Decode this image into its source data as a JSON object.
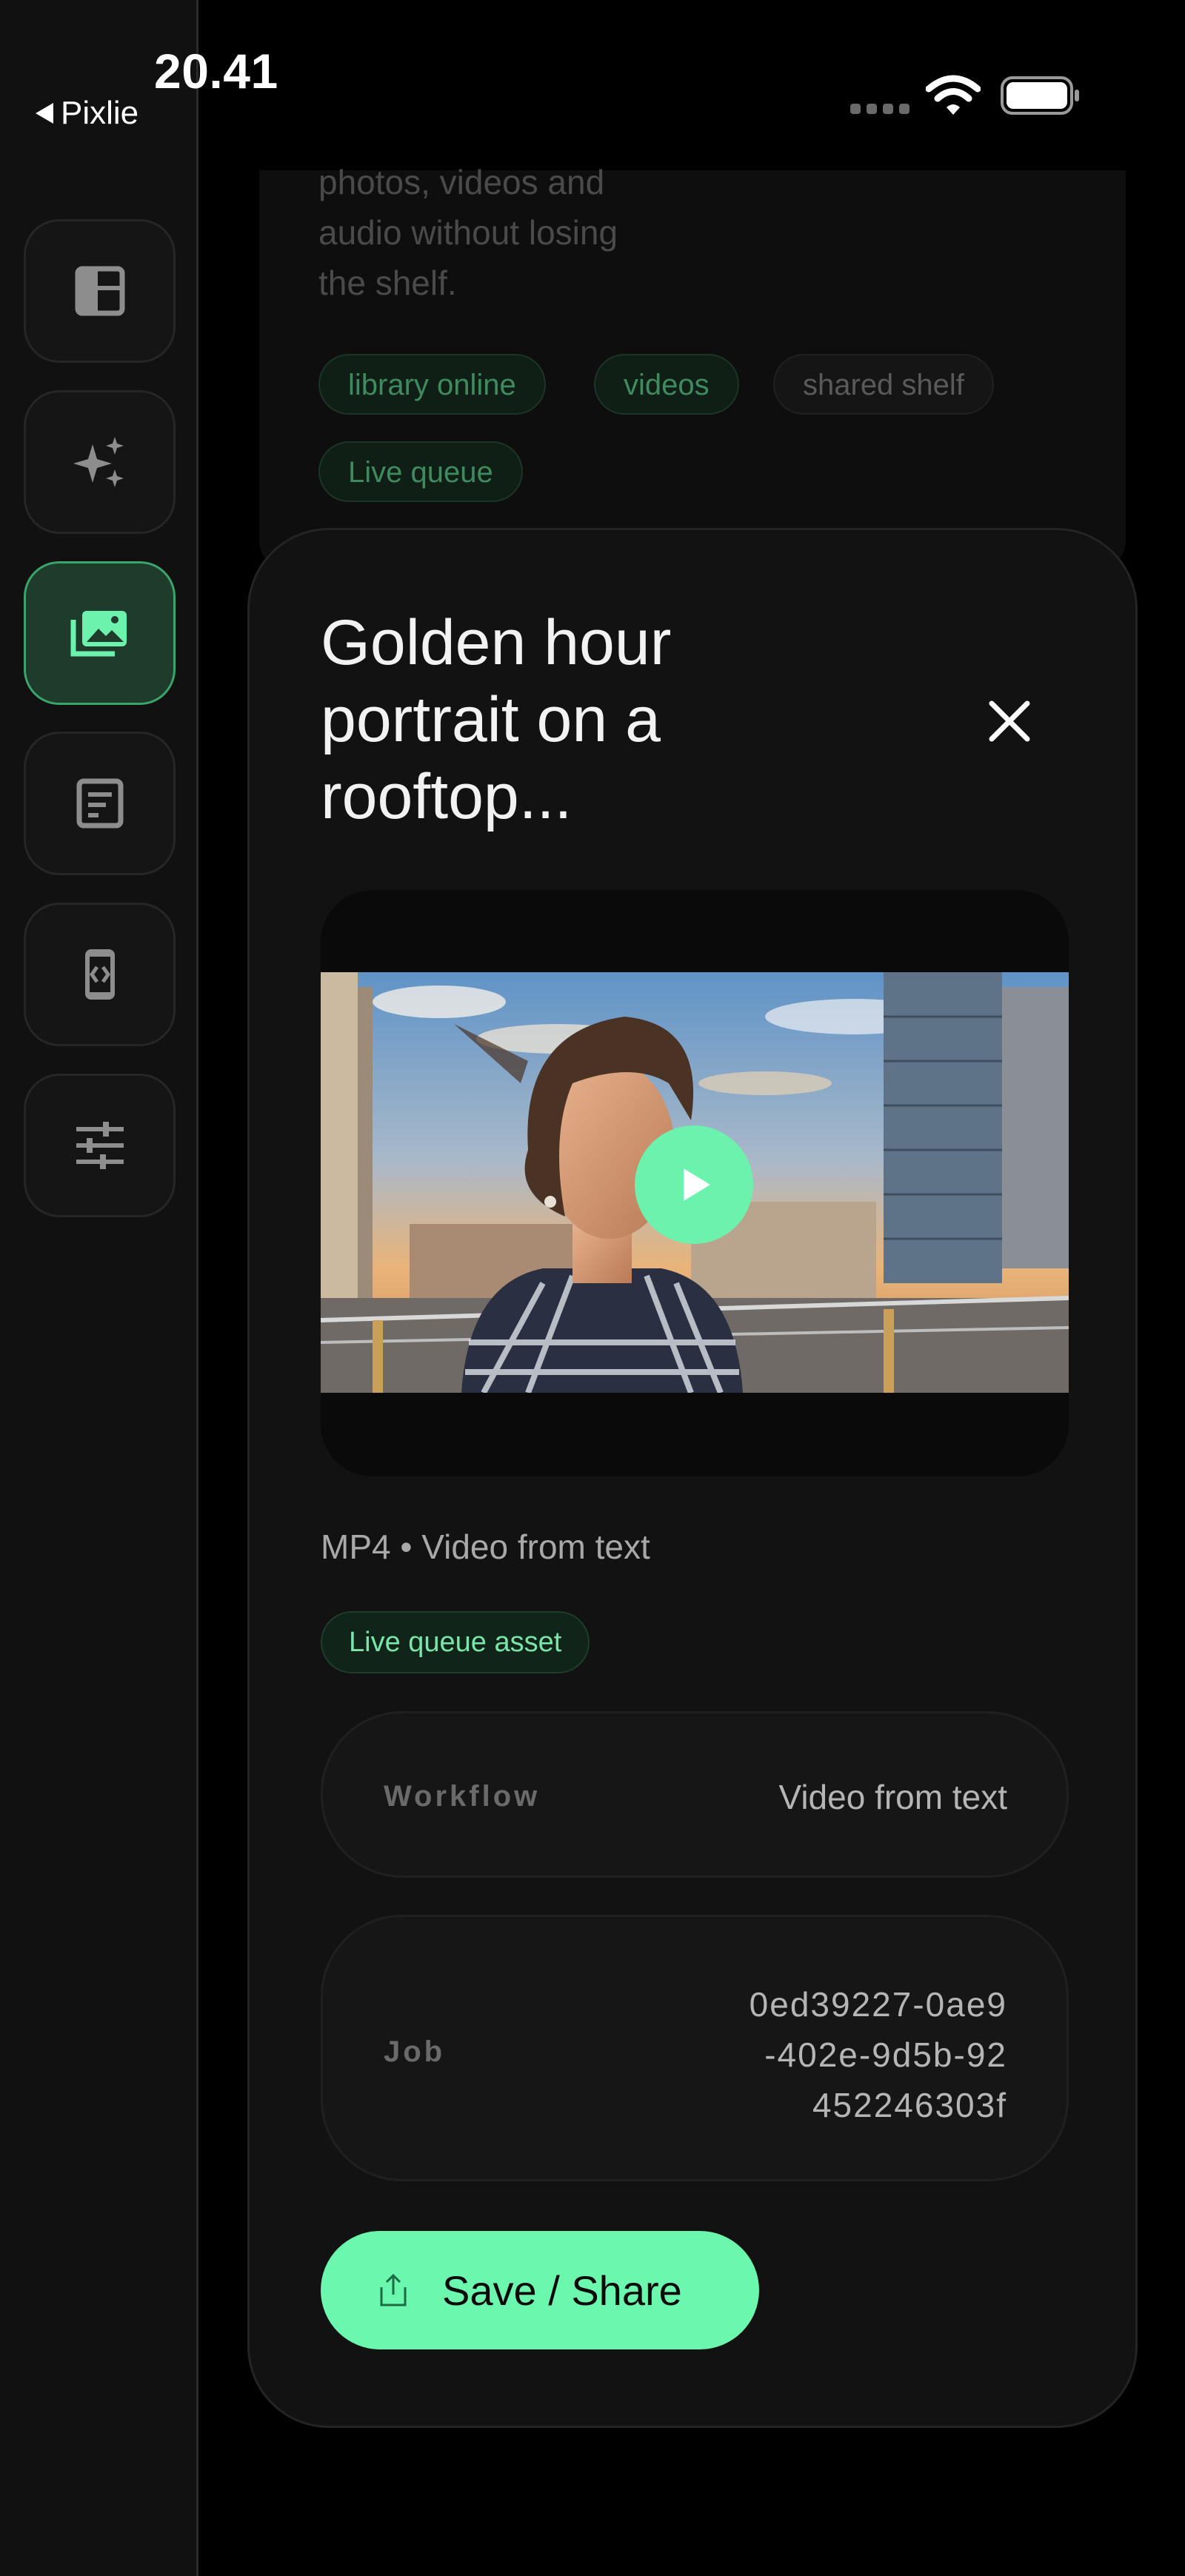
{
  "status_bar": {
    "time": "20.41",
    "back_app": "Pixlie"
  },
  "sidebar": {
    "items": [
      {
        "icon": "dashboard-icon",
        "active": false
      },
      {
        "icon": "sparkles-icon",
        "active": false
      },
      {
        "icon": "gallery-icon",
        "active": true
      },
      {
        "icon": "document-icon",
        "active": false
      },
      {
        "icon": "device-code-icon",
        "active": false
      },
      {
        "icon": "sliders-icon",
        "active": false
      }
    ]
  },
  "background_panel": {
    "description": "photos, videos and\naudio without losing\nthe shelf.",
    "chips": [
      "library online",
      "videos",
      "shared shelf",
      "Live queue"
    ]
  },
  "modal": {
    "title": "Golden hour portrait on a rooftop...",
    "meta": "MP4 • Video from text",
    "badge": "Live queue asset",
    "rows": [
      {
        "label": "Workflow",
        "value": "Video from text"
      },
      {
        "label": "Job",
        "value": "0ed39227-0ae9\n-402e-9d5b-92\n452246303f"
      }
    ],
    "save_button": "Save / Share"
  },
  "colors": {
    "accent": "#6cf7ae",
    "active_nav_bg": "#1f3b2c",
    "active_nav_border": "#3aa56b",
    "background": "#000000"
  }
}
